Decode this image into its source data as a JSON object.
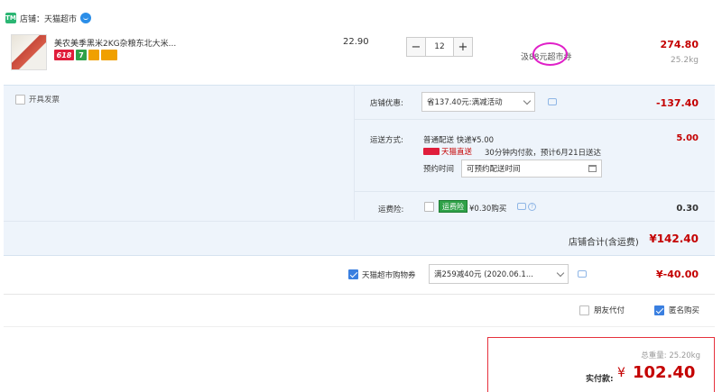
{
  "store": {
    "logo_text": "TM",
    "name": "店铺：天猫超市"
  },
  "item": {
    "title": "美农美季黑米2KG杂粮东北大米...",
    "badges": [
      "618",
      "7"
    ],
    "unit_price": "22.90",
    "quantity": "12",
    "minus": "−",
    "plus": "+",
    "shipping_note": "汲88元超市券",
    "total": "274.80",
    "weight": "25.2kg"
  },
  "invoice": {
    "label": "开具发票"
  },
  "promo": {
    "label": "店铺优惠:",
    "selected": "省137.40元:满减活动",
    "amount": "-137.40"
  },
  "delivery": {
    "label": "运送方式:",
    "main": "普通配送 快递¥5.00",
    "tmall_text": "天猫直送",
    "promise": "30分钟内付款，预计6月21日送达",
    "appointment_label": "预约时间",
    "appointment_placeholder": "可预约配送时间",
    "amount": "5.00"
  },
  "insurance": {
    "label": "运费险:",
    "tag": "运费险",
    "price": "¥0.30购买",
    "help": "?",
    "amount": "0.30"
  },
  "subtotal": {
    "label": "店铺合计(含运费)",
    "amount": "¥142.40"
  },
  "coupon": {
    "label": "天猫超市购物券",
    "selected": "满259减40元 (2020.06.1...",
    "amount": "¥-40.00"
  },
  "options": {
    "friend_pay": "朋友代付",
    "anonymous": "匿名购买"
  },
  "payment": {
    "total_weight": "总重量: 25.20kg",
    "label": "实付款:",
    "currency": "¥",
    "amount": "102.40"
  },
  "colors": {
    "accent_red": "#c40000",
    "section_blue": "#eef4fb",
    "check_blue": "#3a7fe0",
    "annotation": "#e020c8"
  }
}
